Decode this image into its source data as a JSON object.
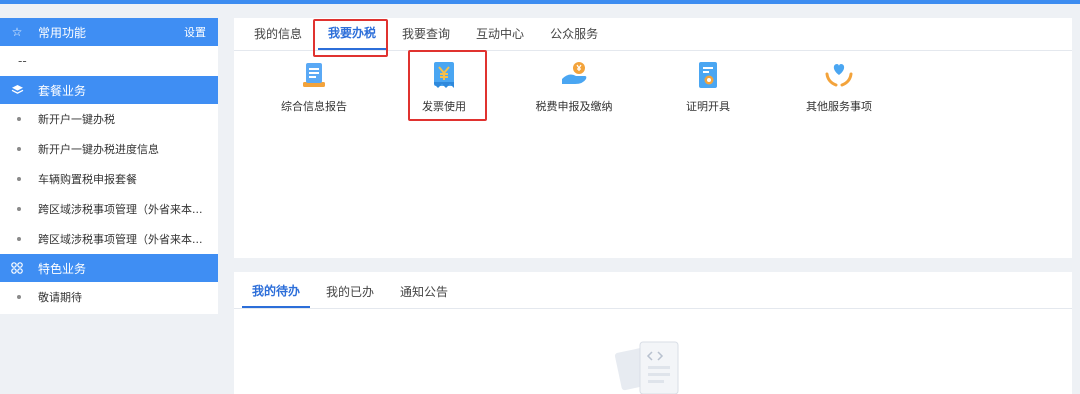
{
  "sidebar": {
    "common": {
      "title": "常用功能",
      "settings_label": "设置",
      "placeholder_row": "--"
    },
    "package": {
      "title": "套餐业务",
      "items": [
        {
          "label": "新开户一键办税"
        },
        {
          "label": "新开户一键办税进度信息"
        },
        {
          "label": "车辆购置税申报套餐"
        },
        {
          "label": "跨区域涉税事项管理（外省来本..."
        },
        {
          "label": "跨区域涉税事项管理（外省来本..."
        }
      ]
    },
    "special": {
      "title": "特色业务",
      "items": [
        {
          "label": "敬请期待"
        }
      ]
    }
  },
  "main": {
    "tabs": [
      {
        "label": "我的信息"
      },
      {
        "label": "我要办税"
      },
      {
        "label": "我要查询"
      },
      {
        "label": "互动中心"
      },
      {
        "label": "公众服务"
      }
    ],
    "active_tab": "我要办税",
    "services": [
      {
        "label": "综合信息报告",
        "icon": "report-icon"
      },
      {
        "label": "发票使用",
        "icon": "invoice-yuan-icon"
      },
      {
        "label": "税费申报及缴纳",
        "icon": "tax-payment-icon"
      },
      {
        "label": "证明开具",
        "icon": "certificate-icon"
      },
      {
        "label": "其他服务事项",
        "icon": "heart-hands-icon"
      }
    ]
  },
  "tasks": {
    "tabs": [
      {
        "label": "我的待办"
      },
      {
        "label": "我的已办"
      },
      {
        "label": "通知公告"
      }
    ],
    "active_tab": "我的待办"
  },
  "colors": {
    "accent": "#3f8ef3",
    "active_tab": "#2c6ed9",
    "highlight": "#e0322f",
    "icon_orange": "#f3a33b"
  }
}
